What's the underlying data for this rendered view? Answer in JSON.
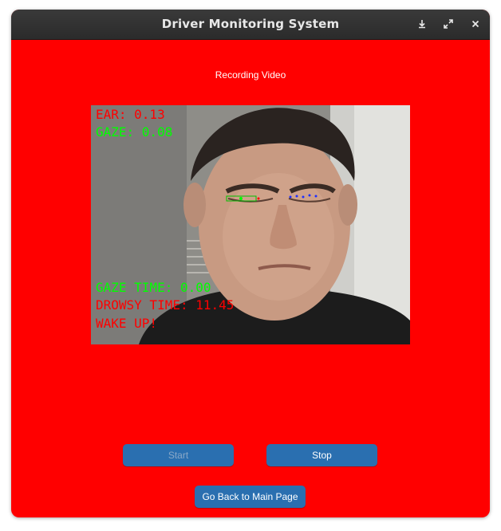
{
  "window": {
    "title": "Driver Monitoring System",
    "controls": [
      "download-icon",
      "maximize-icon",
      "close-icon"
    ]
  },
  "content": {
    "heading": "Recording Video",
    "background_color": "#ff0000"
  },
  "video": {
    "ear_text": "EAR: 0.13",
    "gaze_text": "GAZE: 0.08",
    "gaze_time_text": "GAZE TIME: 0.00",
    "drowsy_time_text": "DROWSY TIME: 11.45",
    "alert_text": "WAKE UP!",
    "overlay_colors": {
      "warning": "#ff0000",
      "ok": "#00ff00"
    }
  },
  "buttons": {
    "start_label": "Start",
    "start_enabled": false,
    "stop_label": "Stop",
    "stop_enabled": true,
    "back_label": "Go Back to Main Page",
    "color": "#2a6fb0"
  }
}
